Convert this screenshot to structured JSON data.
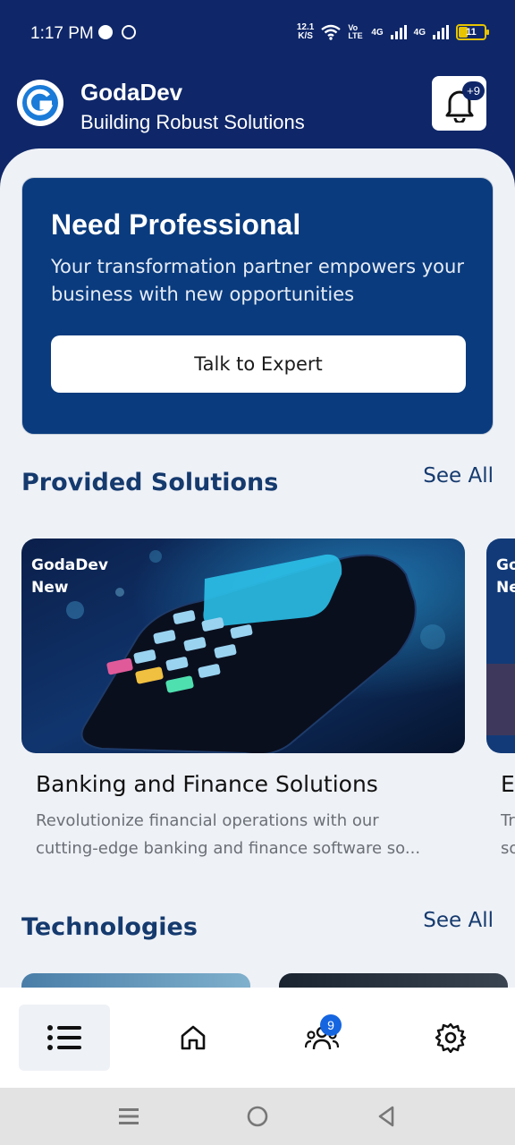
{
  "status_bar": {
    "time": "1:17 PM",
    "net_speed_value": "12.1",
    "net_speed_unit": "K/S",
    "volte": "Vo LTE",
    "network_1": "4G",
    "network_2": "4G",
    "battery": "11"
  },
  "header": {
    "title": "GodaDev",
    "subtitle": "Building Robust Solutions",
    "notification_count": "+9"
  },
  "hero": {
    "title": "Need Professional",
    "text": "Your transformation partner empowers your business with new opportunities",
    "button_label": "Talk to Expert"
  },
  "solutions": {
    "title": "Provided Solutions",
    "see_all": "See All",
    "cards": [
      {
        "badge_line1": "GodaDev",
        "badge_line2": "New",
        "title": "Banking and Finance Solutions",
        "desc_line1": "Revolutionize financial operations with our",
        "desc_line2": "cutting-edge banking and finance software so..."
      },
      {
        "badge_line1": "Go",
        "badge_line2": "Ne",
        "title": "E",
        "desc_line1": "Tr",
        "desc_line2": "so"
      }
    ]
  },
  "technologies": {
    "title": "Technologies",
    "see_all": "See All"
  },
  "bottom_nav": {
    "items": [
      {
        "icon": "list-icon",
        "active": true
      },
      {
        "icon": "home-icon",
        "active": false
      },
      {
        "icon": "users-icon",
        "active": false,
        "badge": "9"
      },
      {
        "icon": "gear-icon",
        "active": false
      }
    ]
  },
  "colors": {
    "primary": "#0f2769",
    "hero_bg": "#0a3b7e",
    "section_title": "#153a6e",
    "badge_blue": "#1565e0",
    "content_bg": "#eef1f6"
  }
}
